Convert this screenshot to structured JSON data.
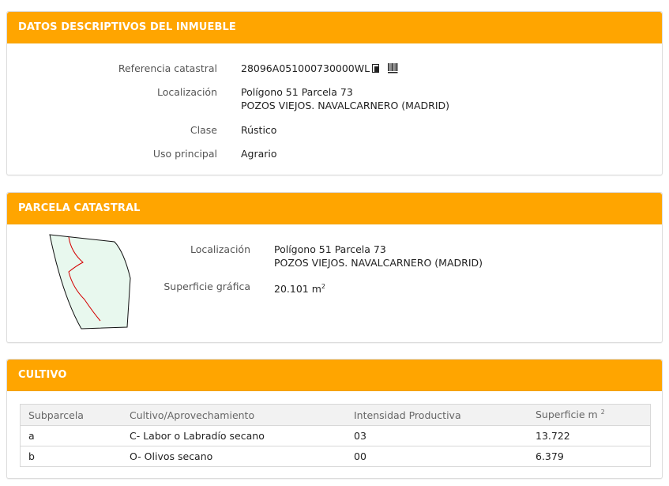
{
  "datos": {
    "title": "DATOS DESCRIPTIVOS DEL INMUEBLE",
    "ref_label": "Referencia catastral",
    "ref_value": "28096A051000730000WL",
    "loc_label": "Localización",
    "loc_line1": "Polígono 51 Parcela 73",
    "loc_line2": "POZOS VIEJOS. NAVALCARNERO (MADRID)",
    "clase_label": "Clase",
    "clase_value": "Rústico",
    "uso_label": "Uso principal",
    "uso_value": "Agrario",
    "icons": [
      "copy-icon",
      "barcode-icon"
    ]
  },
  "parcela": {
    "title": "PARCELA CATASTRAL",
    "loc_label": "Localización",
    "loc_line1": "Polígono 51 Parcela 73",
    "loc_line2": "POZOS VIEJOS. NAVALCARNERO (MADRID)",
    "sup_label": "Superficie gráfica",
    "sup_value": "20.101 m",
    "sup_exp": "2",
    "map_fill": "#e8f8ee",
    "line_color": "#d40000"
  },
  "cultivo": {
    "title": "CULTIVO",
    "headers": [
      "Subparcela",
      "Cultivo/Aprovechamiento",
      "Intensidad Productiva",
      "Superficie m"
    ],
    "header_exp": "2",
    "rows": [
      [
        "a",
        "C- Labor o Labradío secano",
        "03",
        "13.722"
      ],
      [
        "b",
        "O- Olivos secano",
        "00",
        "6.379"
      ]
    ]
  },
  "colors": {
    "header_bg": "#ffa500",
    "header_text": "#ffffff"
  }
}
